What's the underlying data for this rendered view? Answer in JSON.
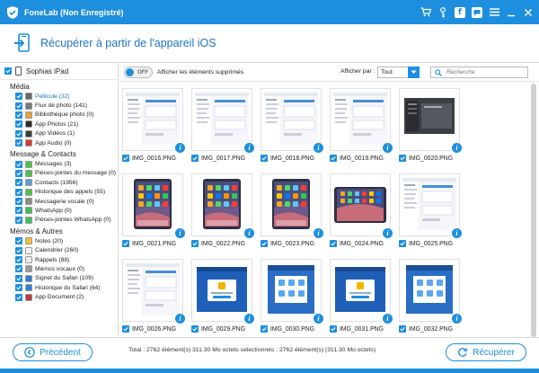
{
  "window": {
    "title": "FoneLab (Non Enregistré)"
  },
  "header": {
    "title": "Récupérer à partir de l'appareil iOS"
  },
  "sidebar": {
    "device": "Sophias iPad",
    "sections": [
      {
        "title": "Média",
        "items": [
          {
            "label": "Pellicule (32)",
            "icon": "film-icon",
            "color": "#6a6a6a",
            "active": true
          },
          {
            "label": "Flux de photo (141)",
            "icon": "photo-stream-icon",
            "color": "#777777"
          },
          {
            "label": "Bibliothèque photo (0)",
            "icon": "photos-icon",
            "color": "#e8a13a"
          },
          {
            "label": "App Photos (21)",
            "icon": "app-photos-icon",
            "color": "#2a2a2a"
          },
          {
            "label": "App Vidéos (1)",
            "icon": "app-videos-icon",
            "color": "#3a3a3a"
          },
          {
            "label": "App Audio (0)",
            "icon": "app-audio-icon",
            "color": "#d83a3a"
          }
        ]
      },
      {
        "title": "Message & Contacts",
        "items": [
          {
            "label": "Messages (3)",
            "icon": "messages-icon",
            "color": "#4cc24c"
          },
          {
            "label": "Pièces-jointes du message (0)",
            "icon": "message-attachment-icon",
            "color": "#4cc24c"
          },
          {
            "label": "Contacts (1956)",
            "icon": "contacts-icon",
            "color": "#5aa0e0"
          },
          {
            "label": "Historique des appels (55)",
            "icon": "phone-icon",
            "color": "#4cc24c"
          },
          {
            "label": "Messagerie vocale (0)",
            "icon": "voicemail-icon",
            "color": "#8a8a8a"
          },
          {
            "label": "WhatsApp (0)",
            "icon": "whatsapp-icon",
            "color": "#3fbf55"
          },
          {
            "label": "Pièces-jointes WhatsApp (0)",
            "icon": "whatsapp-attachment-icon",
            "color": "#3fbf55"
          }
        ]
      },
      {
        "title": "Mémos & Autres",
        "items": [
          {
            "label": "Notes (20)",
            "icon": "notes-icon",
            "color": "#f0c030"
          },
          {
            "label": "Calendrier (260)",
            "icon": "calendar-icon",
            "color": "#f4f4f4"
          },
          {
            "label": "Rappels (88)",
            "icon": "reminders-icon",
            "color": "#eeeeee"
          },
          {
            "label": "Mémos vocaux (0)",
            "icon": "voice-memo-icon",
            "color": "#999999"
          },
          {
            "label": "Signet du Safari (109)",
            "icon": "safari-bookmark-icon",
            "color": "#2f7fd6"
          },
          {
            "label": "Historique du Safari (64)",
            "icon": "safari-history-icon",
            "color": "#2f7fd6"
          },
          {
            "label": "App Document (2)",
            "icon": "app-document-icon",
            "color": "#c03a3a"
          }
        ]
      }
    ]
  },
  "toolbar": {
    "toggle_state": "OFF",
    "toggle_label": "Afficher les éléments supprimés",
    "display_label": "Afficher par :",
    "display_value": "Tout",
    "search_placeholder": "Recherche"
  },
  "thumbnails": [
    {
      "name": "IMG_0016.PNG",
      "style": "white"
    },
    {
      "name": "IMG_0017.PNG",
      "style": "white"
    },
    {
      "name": "IMG_0018.PNG",
      "style": "white"
    },
    {
      "name": "IMG_0019.PNG",
      "style": "white"
    },
    {
      "name": "IMG_0020.PNG",
      "style": "dark"
    },
    {
      "name": "IMG_0021.PNG",
      "style": "home"
    },
    {
      "name": "IMG_0022.PNG",
      "style": "home"
    },
    {
      "name": "IMG_0023.PNG",
      "style": "home"
    },
    {
      "name": "IMG_0024.PNG",
      "style": "homelandscape"
    },
    {
      "name": "IMG_0025.PNG",
      "style": "white"
    },
    {
      "name": "IMG_0026.PNG",
      "style": "white"
    },
    {
      "name": "IMG_0029.PNG",
      "style": "bluedialog"
    },
    {
      "name": "IMG_0030.PNG",
      "style": "bluegrid"
    },
    {
      "name": "IMG_0031.PNG",
      "style": "bluedialog"
    },
    {
      "name": "IMG_0032.PNG",
      "style": "bluegrid"
    }
  ],
  "footer": {
    "prev_label": "Précédent",
    "next_label": "Récupérer",
    "total_text": "Total : 2762 élément(s) 311.30 Mo octets sélectionnés : 2762 élément(s) (311.30 Mo octets)"
  },
  "colors": {
    "accent": "#1e8fde",
    "header_text": "#1f74c2"
  }
}
